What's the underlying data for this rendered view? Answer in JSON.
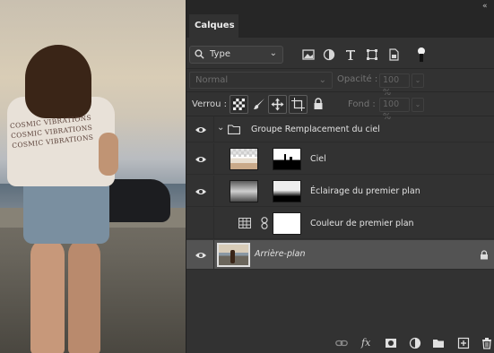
{
  "photo": {
    "shirt_lines": [
      "COSMIC VIBRATIONS",
      "COSMIC VIBRATIONS",
      "COSMIC VIBRATIONS"
    ]
  },
  "panel": {
    "tab_label": "Calques",
    "filter": {
      "label": "Type",
      "icons": [
        "image-filter-icon",
        "adjustment-filter-icon",
        "type-filter-icon",
        "shape-filter-icon",
        "smart-object-filter-icon"
      ]
    },
    "blend_mode": "Normal",
    "opacity_label": "Opacité :",
    "opacity_value": "100 %",
    "lock_label": "Verrou :",
    "fill_label": "Fond :",
    "fill_value": "100 %"
  },
  "layers": [
    {
      "name": "Groupe Remplacement du ciel",
      "kind": "group",
      "visible": true
    },
    {
      "name": "Ciel",
      "kind": "image-with-mask",
      "visible": true
    },
    {
      "name": "Éclairage du premier plan",
      "kind": "adjustment-with-mask",
      "visible": true
    },
    {
      "name": "Couleur de premier plan",
      "kind": "fill-with-mask",
      "visible": true
    },
    {
      "name": "Arrière-plan",
      "kind": "background",
      "visible": true,
      "locked": true,
      "selected": true
    }
  ],
  "bottom_icons": [
    "link-layers-icon",
    "fx-icon",
    "add-mask-icon",
    "adjustment-layer-icon",
    "new-group-icon",
    "new-layer-icon",
    "delete-layer-icon"
  ],
  "colors": {
    "panel_bg": "#323232",
    "selected_row": "#535353",
    "tab_bar": "#262626"
  }
}
